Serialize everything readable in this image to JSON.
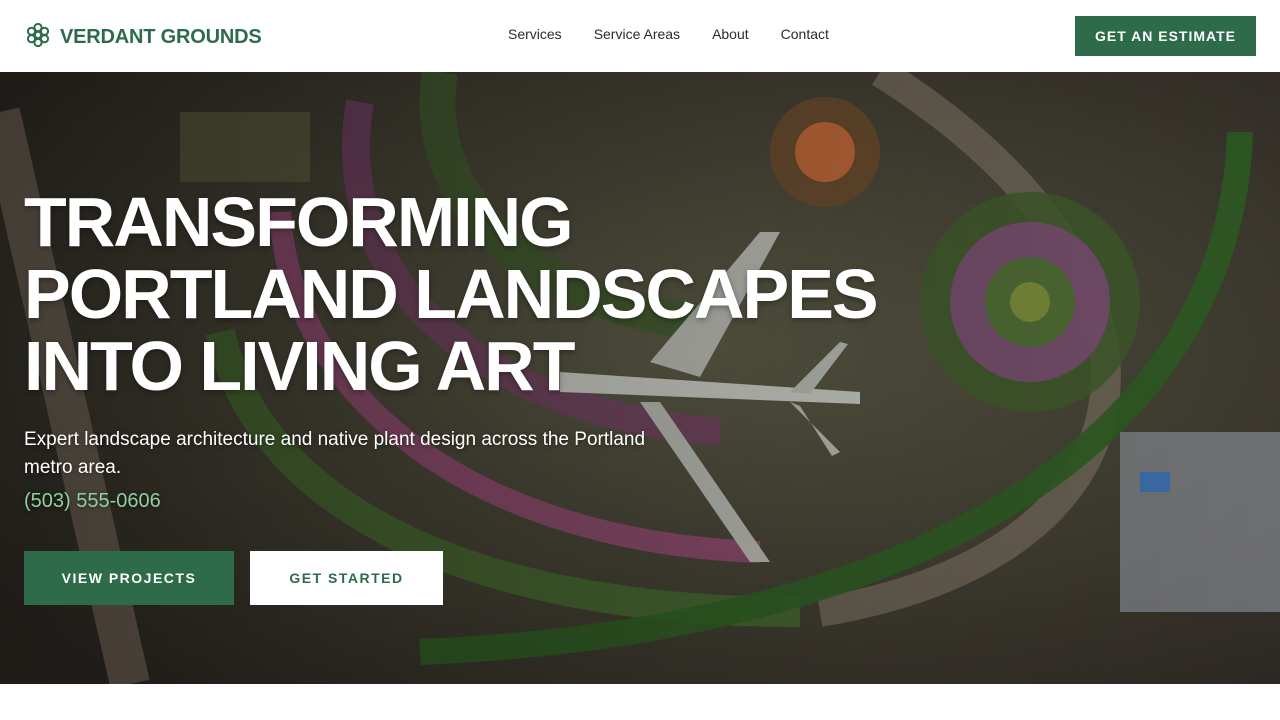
{
  "brand": {
    "name": "VERDANT GROUNDS",
    "logo_icon": "flower-icon",
    "color": "#2e6b4b"
  },
  "nav": {
    "items": [
      "Services",
      "Service Areas",
      "About",
      "Contact"
    ]
  },
  "header": {
    "cta_label": "GET AN ESTIMATE"
  },
  "hero": {
    "headline": [
      "TRANSFORMING",
      "PORTLAND LANDSCAPES",
      "INTO LIVING ART"
    ],
    "subtitle": "Expert landscape architecture and native plant design across the Portland metro area.",
    "phone": "(503) 555-0606",
    "primary_button": "VIEW PROJECTS",
    "secondary_button": "GET STARTED",
    "background": "aerial-garden-photo"
  },
  "colors": {
    "accent": "#2e6b4b",
    "phone": "#8fd19e"
  }
}
